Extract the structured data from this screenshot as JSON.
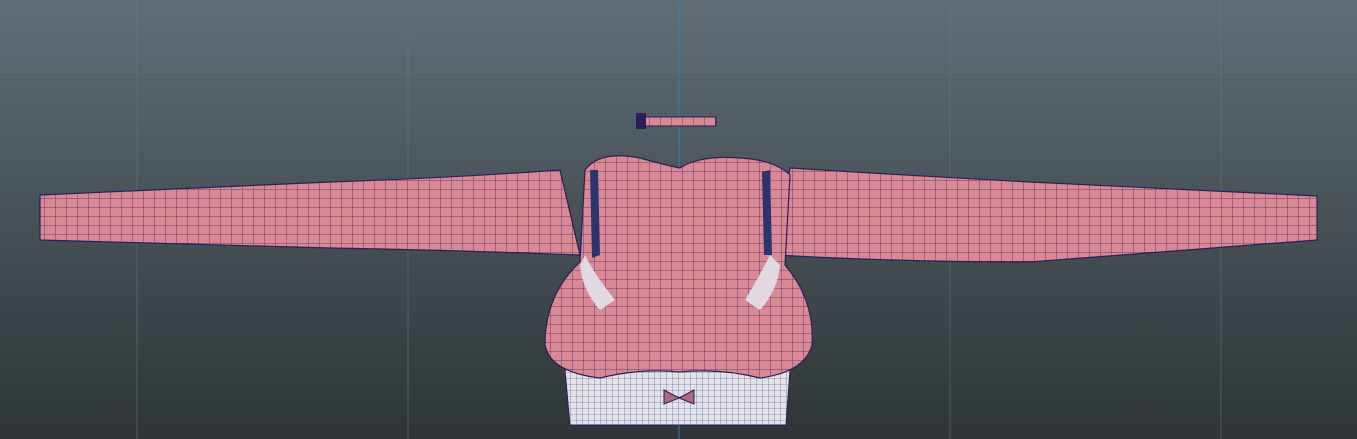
{
  "viewport": {
    "colors": {
      "background_top": "#5f6e76",
      "background_bottom": "#2e3437",
      "grid_line": "#6b7a82",
      "axis_line": "#3a7fa0",
      "mesh_fill": "#d98894",
      "mesh_wire": "#2a1f5a",
      "inner_fill": "#e2e2ea",
      "strap": "#2c3470"
    }
  }
}
